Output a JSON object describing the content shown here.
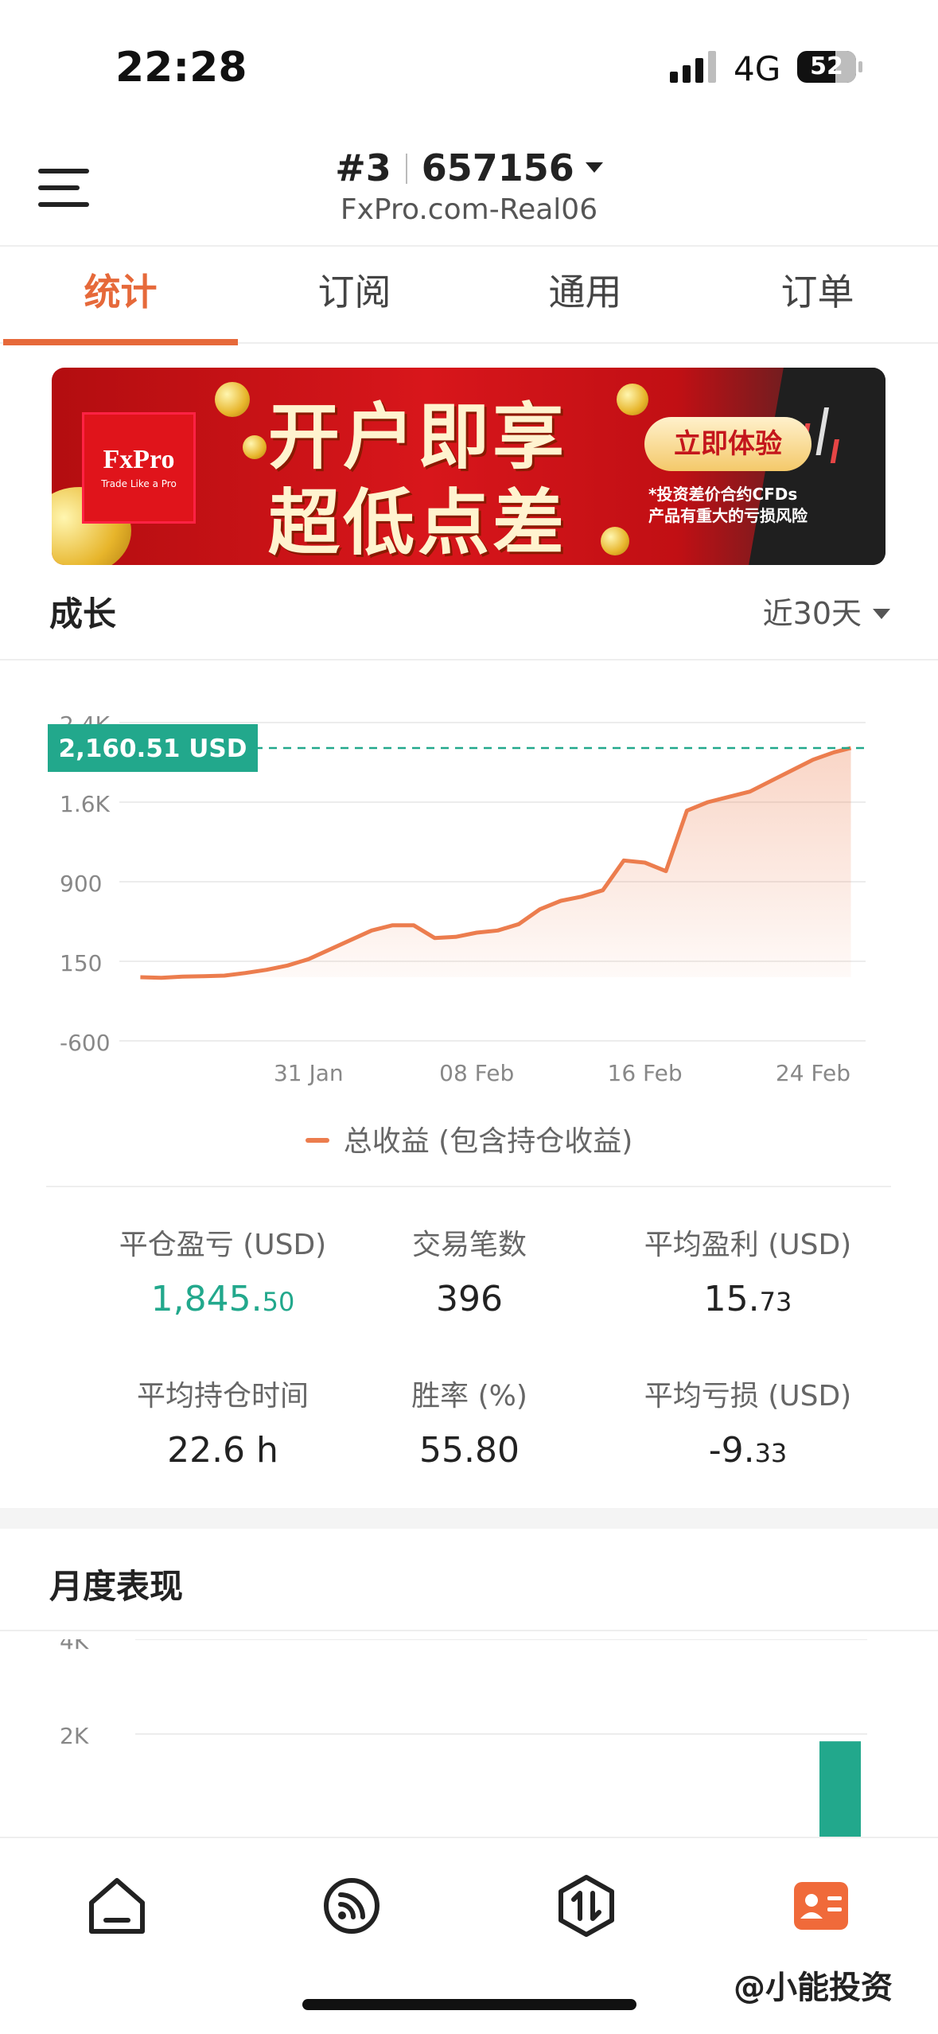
{
  "status": {
    "time": "22:28",
    "network": "4G",
    "battery": "52"
  },
  "header": {
    "account_number": "#3",
    "account_id": "657156",
    "server": "FxPro.com-Real06",
    "menu_icon": "hamburger-icon"
  },
  "tabs": [
    {
      "label": "统计",
      "active": true
    },
    {
      "label": "订阅",
      "active": false
    },
    {
      "label": "通用",
      "active": false
    },
    {
      "label": "订单",
      "active": false
    }
  ],
  "banner": {
    "logo_name": "FxPro",
    "logo_tagline": "Trade Like a Pro",
    "headline_1": "开户即享",
    "headline_2": "超低点差",
    "cta": "立即体验",
    "risk_line_1": "*投资差价合约CFDs",
    "risk_line_2": "产品有重大的亏损风险"
  },
  "growth": {
    "title": "成长",
    "range_label": "近30天"
  },
  "chart_data": {
    "type": "area",
    "current_value_label": "2,160.51 USD",
    "ytick_labels": [
      "2.4K",
      "1.6K",
      "900",
      "150",
      "-600"
    ],
    "yticks": [
      2400,
      1650,
      900,
      150,
      -600
    ],
    "ylim": [
      -600,
      2400
    ],
    "xtick_labels": [
      "31 Jan",
      "08 Feb",
      "16 Feb",
      "24 Feb"
    ],
    "xticks": [
      8,
      16,
      24,
      32
    ],
    "xlim": [
      -1,
      34.5
    ],
    "series": [
      {
        "name": "总收益 (包含持仓收益)",
        "color": "#ec7d4e",
        "x": [
          0,
          1,
          2,
          3,
          4,
          5,
          6,
          7,
          8,
          9,
          10,
          11,
          12,
          13,
          14,
          15,
          16,
          17,
          18,
          19,
          20,
          21,
          22,
          23,
          24,
          25,
          26,
          27,
          28,
          29,
          30,
          31,
          32,
          33,
          33.8
        ],
        "values": [
          0,
          -5,
          5,
          10,
          15,
          40,
          70,
          110,
          170,
          260,
          350,
          440,
          490,
          490,
          370,
          380,
          420,
          440,
          500,
          640,
          720,
          760,
          820,
          1100,
          1080,
          1000,
          1570,
          1650,
          1700,
          1750,
          1850,
          1950,
          2050,
          2120,
          2160
        ]
      }
    ],
    "legend": "总收益 (包含持仓收益)",
    "legend_position": "bottom"
  },
  "stats": [
    {
      "label": "平仓盈亏 (USD)",
      "int": "1,845.",
      "dec": "50",
      "green": true
    },
    {
      "label": "交易笔数",
      "int": "396",
      "dec": "",
      "green": false
    },
    {
      "label": "平均盈利 (USD)",
      "int": "15.",
      "dec": "73",
      "green": false
    },
    {
      "label": "平均持仓时间",
      "int": "22.6 h",
      "dec": "",
      "green": false
    },
    {
      "label": "胜率 (%)",
      "int": "55.80",
      "dec": "",
      "green": false
    },
    {
      "label": "平均亏损 (USD)",
      "int": "-9.",
      "dec": "33",
      "green": false
    }
  ],
  "monthly": {
    "title": "月度表现",
    "chart": {
      "type": "bar",
      "ytick_labels": [
        "4K",
        "2K"
      ],
      "yticks": [
        4000,
        2000
      ],
      "bar_value": 1845.5,
      "bar_color": "#22a88c"
    }
  },
  "nav": [
    {
      "icon": "home-icon"
    },
    {
      "icon": "feed-icon"
    },
    {
      "icon": "trade-icon"
    },
    {
      "icon": "profile-card-icon",
      "active": true
    }
  ],
  "watermark": "@小能投资"
}
